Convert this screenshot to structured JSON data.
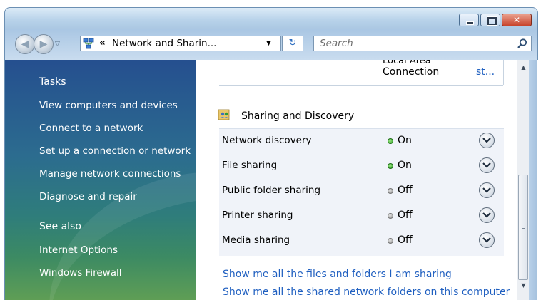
{
  "window": {
    "colors": {
      "title_gradient": "#b9d3ea",
      "sidebar_top": "#254f8f",
      "sidebar_bottom": "#5f9e55",
      "link": "#1f5fc0",
      "status_on": "#2a9a1f",
      "status_off": "#8d8d8d"
    },
    "caption_buttons": [
      "minimize",
      "maximize",
      "close"
    ]
  },
  "navigation": {
    "address": {
      "chevron": "«",
      "path": "Network and Sharin...",
      "dropdown_glyph": "▼"
    },
    "refresh_glyph": "↻",
    "search": {
      "placeholder": "Search"
    }
  },
  "sidebar": {
    "tasks_heading": "Tasks",
    "tasks": [
      "View computers and devices",
      "Connect to a network",
      "Set up a connection or network",
      "Manage network connections",
      "Diagnose and repair"
    ],
    "see_also_heading": "See also",
    "see_also": [
      "Internet Options",
      "Windows Firewall"
    ]
  },
  "main": {
    "cut_text": "Local Area",
    "connection_label": "Connection",
    "connection_link": "st...",
    "section_title": "Sharing and Discovery",
    "sharing": [
      {
        "label": "Network discovery",
        "state": "On",
        "status": "on"
      },
      {
        "label": "File sharing",
        "state": "On",
        "status": "on"
      },
      {
        "label": "Public folder sharing",
        "state": "Off",
        "status": "off"
      },
      {
        "label": "Printer sharing",
        "state": "Off",
        "status": "off"
      },
      {
        "label": "Media sharing",
        "state": "Off",
        "status": "off"
      }
    ],
    "links": [
      "Show me all the files and folders I am sharing",
      "Show me all the shared network folders on this computer"
    ]
  },
  "scrollbar": {
    "up_glyph": "▲",
    "down_glyph": "▼",
    "grip_glyph": "≡"
  }
}
